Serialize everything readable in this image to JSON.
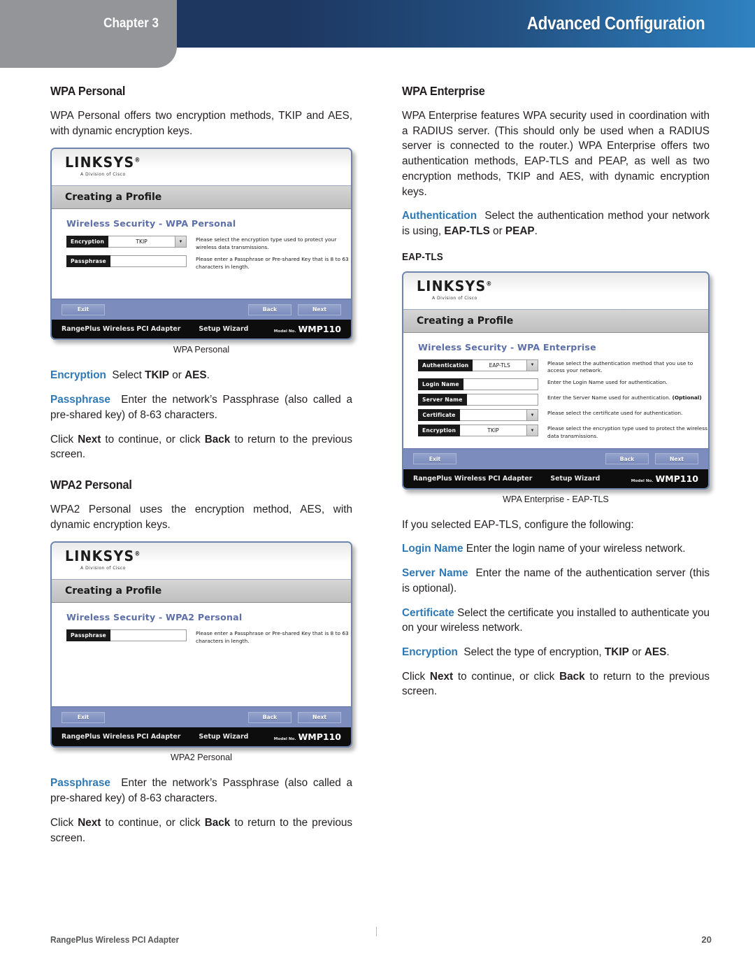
{
  "header": {
    "chapter_label": "Chapter 3",
    "title": "Advanced Configuration",
    "band_color_left": "#1d3660",
    "band_color_right": "#2f82c0",
    "tab_color": "#939598"
  },
  "accent_color": "#2e79b5",
  "left_column": {
    "wpa_personal": {
      "heading": "WPA Personal",
      "intro": "WPA Personal offers two encryption methods, TKIP and AES, with dynamic encryption keys.",
      "figure_caption": "WPA Personal",
      "encryption_label": "Encryption",
      "encryption_text": "Select ",
      "encryption_bold1": "TKIP",
      "encryption_mid": " or ",
      "encryption_bold2": "AES",
      "encryption_end": ".",
      "passphrase_label": "Passphrase",
      "passphrase_text": "Enter the network’s Passphrase (also called a pre-shared key) of 8-63 characters.",
      "click_prefix": "Click ",
      "click_next": "Next",
      "click_mid": " to continue, or click ",
      "click_back": "Back",
      "click_end": " to return to the previous screen."
    },
    "wpa2_personal": {
      "heading": "WPA2 Personal",
      "intro": "WPA2 Personal uses the encryption method, AES, with dynamic encryption keys.",
      "figure_caption": "WPA2 Personal",
      "passphrase_label": "Passphrase",
      "passphrase_text": "Enter the network’s Passphrase (also called a pre-shared key) of 8-63 characters.",
      "click_prefix": "Click ",
      "click_next": "Next",
      "click_mid": " to continue, or click ",
      "click_back": "Back",
      "click_end": " to return to the previous screen."
    }
  },
  "right_column": {
    "wpa_enterprise": {
      "heading": "WPA Enterprise",
      "intro": "WPA Enterprise features WPA security used in coordination with a RADIUS server. (This should only be used when a RADIUS server is connected to the router.) WPA Enterprise offers two authentication methods, EAP-TLS and PEAP, as well as two encryption methods, TKIP and AES, with dynamic encryption keys.",
      "auth_label": "Authentication",
      "auth_text": "Select the authentication method your network is using, ",
      "auth_bold1": "EAP-TLS",
      "auth_mid": " or ",
      "auth_bold2": "PEAP",
      "auth_end": ".",
      "subheading": "EAP-TLS",
      "figure_caption": "WPA Enterprise - EAP-TLS",
      "configure_line": "If you selected EAP-TLS, configure the following:",
      "login_label": "Login Name",
      "login_text": "Enter the login name of your wireless network.",
      "server_label": "Server Name",
      "server_text": "Enter the name of the authentication server (this is optional).",
      "cert_label": "Certificate",
      "cert_text": "Select the certificate you installed to authenticate you on your wireless network.",
      "enc_label": "Encryption",
      "enc_text": "Select the type of encryption, ",
      "enc_bold1": "TKIP",
      "enc_mid": " or ",
      "enc_bold2": "AES",
      "enc_end": ".",
      "click_prefix": "Click ",
      "click_next": "Next",
      "click_mid": " to continue, or click ",
      "click_back": "Back",
      "click_end": " to return to the previous screen."
    }
  },
  "dialogs": {
    "wpa_personal": {
      "brand": "LINKSYS",
      "brand_sub": "A Division of Cisco",
      "title": "Creating a Profile",
      "section_title": "Wireless Security - WPA Personal",
      "fields": [
        {
          "label": "Encryption",
          "value": "TKIP",
          "dropdown": true,
          "help": "Please select the encryption type used to protect your wireless data transmissions."
        },
        {
          "label": "Passphrase",
          "value": "",
          "dropdown": false,
          "help": "Please enter a Passphrase or Pre-shared Key that is 8 to 63 characters in length."
        }
      ],
      "buttons": {
        "exit": "Exit",
        "back": "Back",
        "next": "Next"
      },
      "footer_product": "RangePlus Wireless PCI Adapter",
      "footer_wizard": "Setup Wizard",
      "footer_model_label": "Model No.",
      "footer_model": "WMP110"
    },
    "wpa2_personal": {
      "brand": "LINKSYS",
      "brand_sub": "A Division of Cisco",
      "title": "Creating a Profile",
      "section_title": "Wireless Security - WPA2 Personal",
      "fields": [
        {
          "label": "Passphrase",
          "value": "",
          "dropdown": false,
          "help": "Please enter a Passphrase or Pre-shared Key that is 8 to 63 characters in length."
        }
      ],
      "buttons": {
        "exit": "Exit",
        "back": "Back",
        "next": "Next"
      },
      "footer_product": "RangePlus Wireless PCI Adapter",
      "footer_wizard": "Setup Wizard",
      "footer_model_label": "Model No.",
      "footer_model": "WMP110"
    },
    "wpa_enterprise": {
      "brand": "LINKSYS",
      "brand_sub": "A Division of Cisco",
      "title": "Creating a Profile",
      "section_title": "Wireless Security - WPA Enterprise",
      "fields": [
        {
          "label": "Authentication",
          "value": "EAP-TLS",
          "dropdown": true,
          "help": "Please select the authentication method that you use to access your network."
        },
        {
          "label": "Login Name",
          "value": "",
          "dropdown": false,
          "help": "Enter the Login Name used for authentication."
        },
        {
          "label": "Server Name",
          "value": "",
          "dropdown": false,
          "help": "Enter the Server Name used for authentication. (Optional)"
        },
        {
          "label": "Certificate",
          "value": "",
          "dropdown": true,
          "help": "Please select the certificate used for authentication."
        },
        {
          "label": "Encryption",
          "value": "TKIP",
          "dropdown": true,
          "help": "Please select the encryption type used to protect the wireless data transmissions."
        }
      ],
      "buttons": {
        "exit": "Exit",
        "back": "Back",
        "next": "Next"
      },
      "footer_product": "RangePlus Wireless PCI Adapter",
      "footer_wizard": "Setup Wizard",
      "footer_model_label": "Model No.",
      "footer_model": "WMP110"
    }
  },
  "footer": {
    "product": "RangePlus Wireless PCI Adapter",
    "page_number": "20"
  }
}
